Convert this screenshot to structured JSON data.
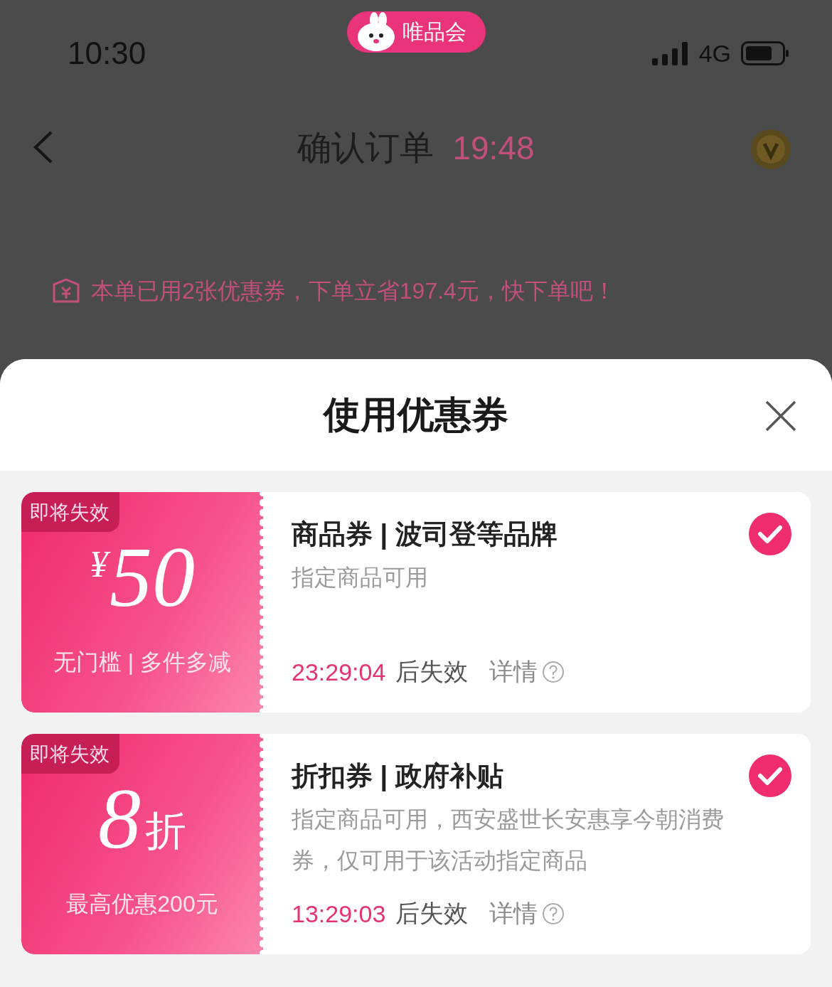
{
  "status_bar": {
    "time": "10:30",
    "app_badge": "唯品会",
    "network": "4G"
  },
  "nav_bar": {
    "title": "确认订单",
    "countdown": "19:48"
  },
  "savings_banner": "本单已用2张优惠券，下单立省197.4元，快下单吧！",
  "coupon_sheet": {
    "title": "使用优惠券",
    "coupons": [
      {
        "kind": "cash",
        "badge": "即将失效",
        "currency": "¥",
        "value": "50",
        "condition": "无门槛 | 多件多减",
        "title": "商品券 | 波司登等品牌",
        "description": "指定商品可用",
        "countdown": "23:29:04",
        "expiry_label": "后失效",
        "details": "详情",
        "selected": true
      },
      {
        "kind": "discount",
        "badge": "即将失效",
        "value": "8",
        "unit": "折",
        "condition": "最高优惠200元",
        "title": "折扣券 | 政府补贴",
        "description": "指定商品可用，西安盛世长安惠享今朝消费券，仅可用于该活动指定商品",
        "countdown": "13:29:03",
        "expiry_label": "后失效",
        "details": "详情",
        "selected": true
      }
    ]
  }
}
